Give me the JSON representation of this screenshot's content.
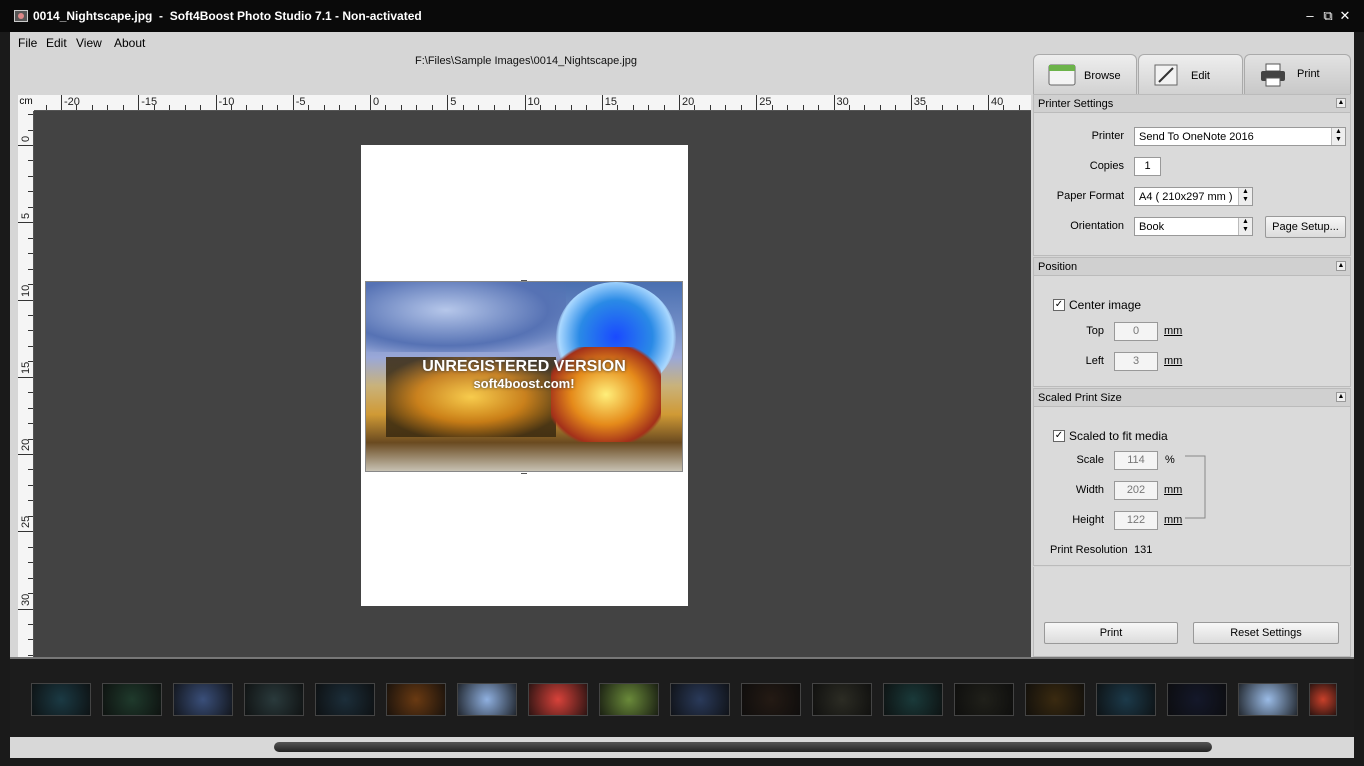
{
  "window": {
    "title": "0014_Nightscape.jpg  -  Soft4Boost Photo Studio 7.1 - Non-activated",
    "controls": {
      "minimize": "–",
      "restore": "⧉",
      "close": "✕"
    }
  },
  "menu": {
    "items": [
      {
        "label": "File",
        "mnemonic": "F"
      },
      {
        "label": "Edit",
        "mnemonic": "E"
      },
      {
        "label": "View",
        "mnemonic": "V"
      },
      {
        "label": "About",
        "mnemonic": "A"
      }
    ]
  },
  "file_path": "F:\\Files\\Sample Images\\0014_Nightscape.jpg",
  "ruler": {
    "unit": "cm",
    "top_labels": [
      "-20",
      "-15",
      "-10",
      "-5",
      "0",
      "5",
      "10",
      "15",
      "20",
      "25",
      "30",
      "35",
      "40"
    ],
    "left_labels": [
      "0",
      "5",
      "10",
      "15",
      "20",
      "25",
      "30"
    ]
  },
  "preview": {
    "watermark_line1": "UNREGISTERED VERSION",
    "watermark_line2": "soft4boost.com!"
  },
  "tabs": [
    {
      "label": "Browse",
      "icon": "browse-icon"
    },
    {
      "label": "Edit",
      "icon": "pencil-icon"
    },
    {
      "label": "Print",
      "icon": "printer-icon",
      "active": true
    }
  ],
  "printer_settings": {
    "title": "Printer Settings",
    "printer_label": "Printer",
    "printer_value": "Send To OneNote 2016",
    "copies_label": "Copies",
    "copies_value": "1",
    "paper_label": "Paper Format",
    "paper_value": "A4 ( 210x297 mm )",
    "orientation_label": "Orientation",
    "orientation_value": "Book",
    "page_setup_button": "Page Setup..."
  },
  "position": {
    "title": "Position",
    "center_label": "Center image",
    "center_checked": true,
    "top_label": "Top",
    "top_value": "0",
    "left_label": "Left",
    "left_value": "3",
    "unit": "mm"
  },
  "scaled": {
    "title": "Scaled Print Size",
    "fit_label": "Scaled to fit media",
    "fit_checked": true,
    "scale_label": "Scale",
    "scale_value": "114",
    "scale_unit": "%",
    "width_label": "Width",
    "width_value": "202",
    "height_label": "Height",
    "height_value": "122",
    "unit": "mm",
    "resolution_label": "Print Resolution",
    "resolution_value": "131"
  },
  "actions": {
    "print_button": "Print",
    "reset_button": "Reset Settings"
  },
  "filmstrip": {
    "thumbnails": [
      {
        "name": "thumb-1",
        "color": "#1b3a44"
      },
      {
        "name": "thumb-2",
        "color": "#1f3a2c"
      },
      {
        "name": "thumb-3",
        "color": "#3a4f7a"
      },
      {
        "name": "thumb-4",
        "color": "#2a3a3c"
      },
      {
        "name": "thumb-5",
        "color": "#1c2e3a"
      },
      {
        "name": "thumb-6",
        "color": "#6a3a12"
      },
      {
        "name": "thumb-7",
        "color": "#8fb0e0"
      },
      {
        "name": "thumb-8",
        "color": "#d8423a"
      },
      {
        "name": "thumb-9",
        "color": "#6a8a3a"
      },
      {
        "name": "thumb-10",
        "color": "#2a3a5a"
      },
      {
        "name": "thumb-11",
        "color": "#241a14"
      },
      {
        "name": "thumb-12",
        "color": "#2c2c24"
      },
      {
        "name": "thumb-13",
        "color": "#1a3a3a"
      },
      {
        "name": "thumb-14",
        "color": "#20201a"
      },
      {
        "name": "thumb-15",
        "color": "#3a2a10"
      },
      {
        "name": "thumb-16",
        "color": "#1c3a4a"
      },
      {
        "name": "thumb-17",
        "color": "#14182a"
      },
      {
        "name": "thumb-18",
        "color": "#9abbe6"
      },
      {
        "name": "thumb-19",
        "color": "#c8402a"
      }
    ]
  }
}
